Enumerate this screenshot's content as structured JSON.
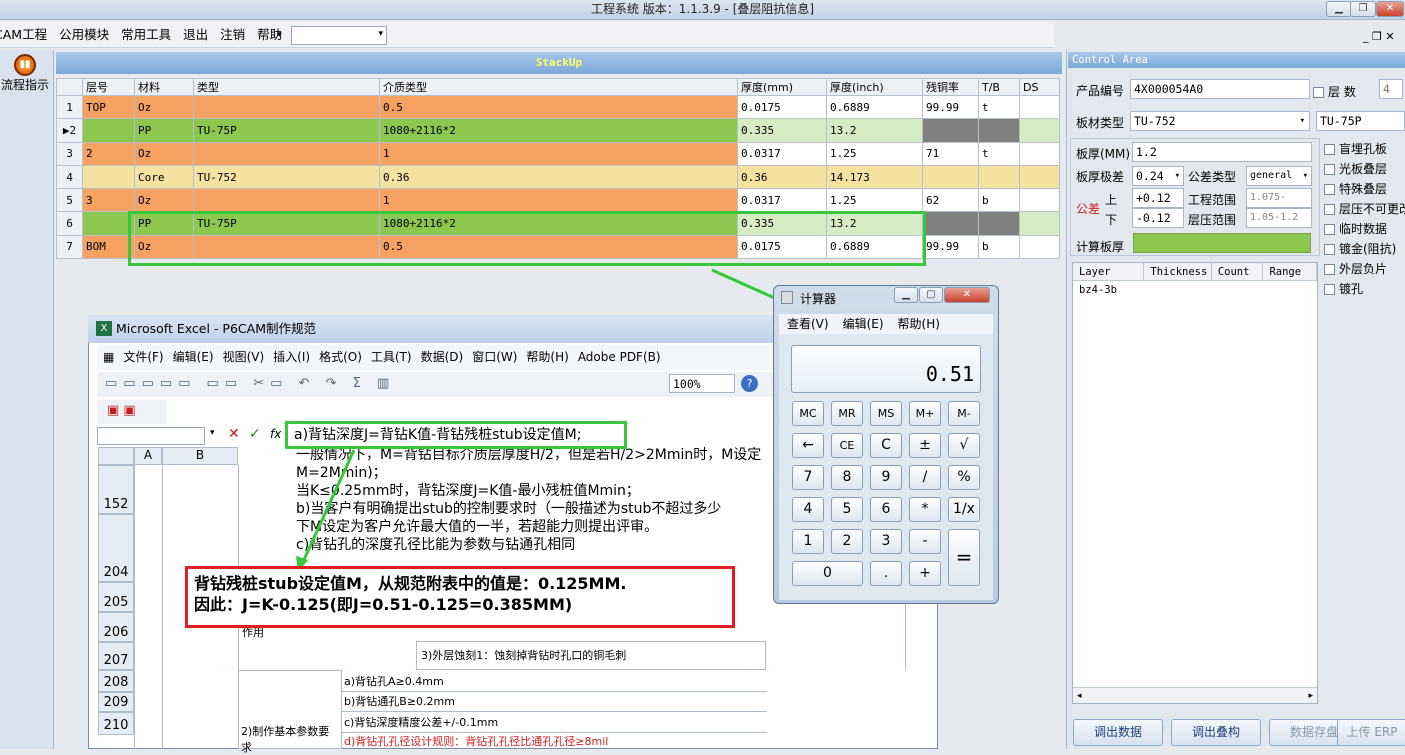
{
  "app": {
    "title": "工程系统  版本：1.1.3.9 - [叠层阻抗信息]"
  },
  "menu": [
    "CAM工程",
    "公用模块",
    "常用工具",
    "退出",
    "注销",
    "帮助"
  ],
  "left": {
    "flow_label": "流程指示"
  },
  "stackup": {
    "title": "StackUp",
    "headers": [
      "层号",
      "材料",
      "类型",
      "介质类型",
      "厚度(mm)",
      "厚度(inch)",
      "残铜率",
      "T/B",
      "DS"
    ],
    "rows": [
      {
        "n": "1",
        "c": [
          "TOP",
          "Oz",
          "",
          "0.5",
          "0.0175",
          "0.6889",
          "99.99",
          "t",
          ""
        ],
        "k": [
          "or",
          "or",
          "or",
          "or",
          "wh",
          "wh",
          "wh",
          "wh",
          "wh"
        ]
      },
      {
        "n": "▶2",
        "c": [
          "",
          "PP",
          "TU-75P",
          "1080+2116*2",
          "0.335",
          "13.2",
          "",
          "",
          ""
        ],
        "k": [
          "gr",
          "gr",
          "gr",
          "gr",
          "lg",
          "lg",
          "gy",
          "gy",
          "lg"
        ]
      },
      {
        "n": "3",
        "c": [
          "2",
          "Oz",
          "",
          "1",
          "0.0317",
          "1.25",
          "71",
          "t",
          ""
        ],
        "k": [
          "or",
          "or",
          "or",
          "or",
          "wh",
          "wh",
          "wh",
          "wh",
          "wh"
        ]
      },
      {
        "n": "4",
        "c": [
          "",
          "Core",
          "TU-752",
          "0.36",
          "0.36",
          "14.173",
          "",
          "",
          ""
        ],
        "k": [
          "ye",
          "ye",
          "ye",
          "ye",
          "ye",
          "ye",
          "ye",
          "ye",
          "ye"
        ]
      },
      {
        "n": "5",
        "c": [
          "3",
          "Oz",
          "",
          "1",
          "0.0317",
          "1.25",
          "62",
          "b",
          ""
        ],
        "k": [
          "or",
          "or",
          "or",
          "or",
          "wh",
          "wh",
          "wh",
          "wh",
          "wh"
        ]
      },
      {
        "n": "6",
        "c": [
          "",
          "PP",
          "TU-75P",
          "1080+2116*2",
          "0.335",
          "13.2",
          "",
          "",
          ""
        ],
        "k": [
          "gr",
          "gr",
          "gr",
          "gr",
          "lg",
          "lg",
          "gy",
          "gy",
          "lg"
        ]
      },
      {
        "n": "7",
        "c": [
          "BOM",
          "Oz",
          "",
          "0.5",
          "0.0175",
          "0.6889",
          "99.99",
          "b",
          ""
        ],
        "k": [
          "or",
          "or",
          "or",
          "or",
          "wh",
          "wh",
          "wh",
          "wh",
          "wh"
        ]
      }
    ]
  },
  "control": {
    "title": "Control Area",
    "product_label": "产品编号",
    "product": "4X000054A0",
    "layers_label": "层 数",
    "layers": "4",
    "material_label": "板材类型",
    "material": "TU-752",
    "material2": "TU-75P",
    "thick_label": "板厚(MM)",
    "thick": "1.2",
    "diff_label": "板厚极差",
    "diff": "0.24",
    "tol_type_label": "公差类型",
    "tol_type": "general",
    "tol_label": "公差",
    "up_label": "上",
    "up": "+0.12",
    "down_label": "下",
    "down": "-0.12",
    "eng_label": "工程范围",
    "eng": "1.075-1.175",
    "press_label": "层压范围",
    "press": "1.05-1.2",
    "calc_label": "计算板厚",
    "checks": [
      "盲埋孔板",
      "光板叠层",
      "特殊叠层",
      "层压不可更改",
      "临时数据",
      "镀金(阻抗)",
      "外层负片",
      "镀孔"
    ],
    "grid_headers": [
      "Layer",
      "Thickness",
      "Count",
      "Range"
    ],
    "grid_row": "bz4-3b",
    "buttons": [
      "调出数据",
      "调出叠构",
      "数据存盘",
      "上传 ERP"
    ]
  },
  "excel": {
    "title": "Microsoft Excel - P6CAM制作规范",
    "menu": [
      "文件(F)",
      "编辑(E)",
      "视图(V)",
      "插入(I)",
      "格式(O)",
      "工具(T)",
      "数据(D)",
      "窗口(W)",
      "帮助(H)",
      "Adobe PDF(B)"
    ],
    "zoom": "100%",
    "fx": "fx",
    "text1": "a)背钻深度J=背钻K值-背钻残桩stub设定值M;",
    "text2": "一般情况下，M=背钻目标介质层厚度H/2，但是若H/2>2Mmin时，M设定",
    "text3": "M=2Mmin)；",
    "text4": "当K≤0.25mm时，背钻深度J=K值-最小残桩值Mmin；",
    "text5": "b)当客户有明确提出stub的控制要求时（一般描述为stub不超过多少",
    "text6": "下M设定为客户允许最大值的一半，若超能力则提出评审。",
    "text7": "c)背钻孔的深度孔径比能为参数与钻通孔相同",
    "rows": [
      "152",
      "204",
      "205",
      "206",
      "207",
      "208",
      "209",
      "210"
    ],
    "col_a": "A",
    "col_b": "B",
    "cell_outer": "3)外层蚀刻1：蚀刻掉背钻时孔口的铜毛刺",
    "cell_a": "a)背钻孔A≥0.4mm",
    "cell_b": "b)背钻通孔B≥0.2mm",
    "cell_c": "c)背钻深度精度公差+/-0.1mm",
    "cell_d": "d)背钻孔孔径设计规则：背钻孔孔径比通孔孔径≥8mil",
    "cell_req": "2)制作基本参数要求",
    "cell_use": "作用"
  },
  "note": {
    "line1": "背钻残桩stub设定值M，从规范附表中的值是：0.125MM.",
    "line2": "因此：J=K-0.125(即J=0.51-0.125=0.385MM)"
  },
  "calc": {
    "title": "计算器",
    "menu": [
      "查看(V)",
      "编辑(E)",
      "帮助(H)"
    ],
    "display": "0.51",
    "keys": [
      [
        "MC",
        "MR",
        "MS",
        "M+",
        "M-"
      ],
      [
        "←",
        "CE",
        "C",
        "±",
        "√"
      ],
      [
        "7",
        "8",
        "9",
        "/",
        "%"
      ],
      [
        "4",
        "5",
        "6",
        "*",
        "1/x"
      ],
      [
        "1",
        "2",
        "3",
        "-",
        ""
      ],
      [
        "0",
        "",
        ".",
        "+",
        ""
      ]
    ],
    "equals": "="
  }
}
